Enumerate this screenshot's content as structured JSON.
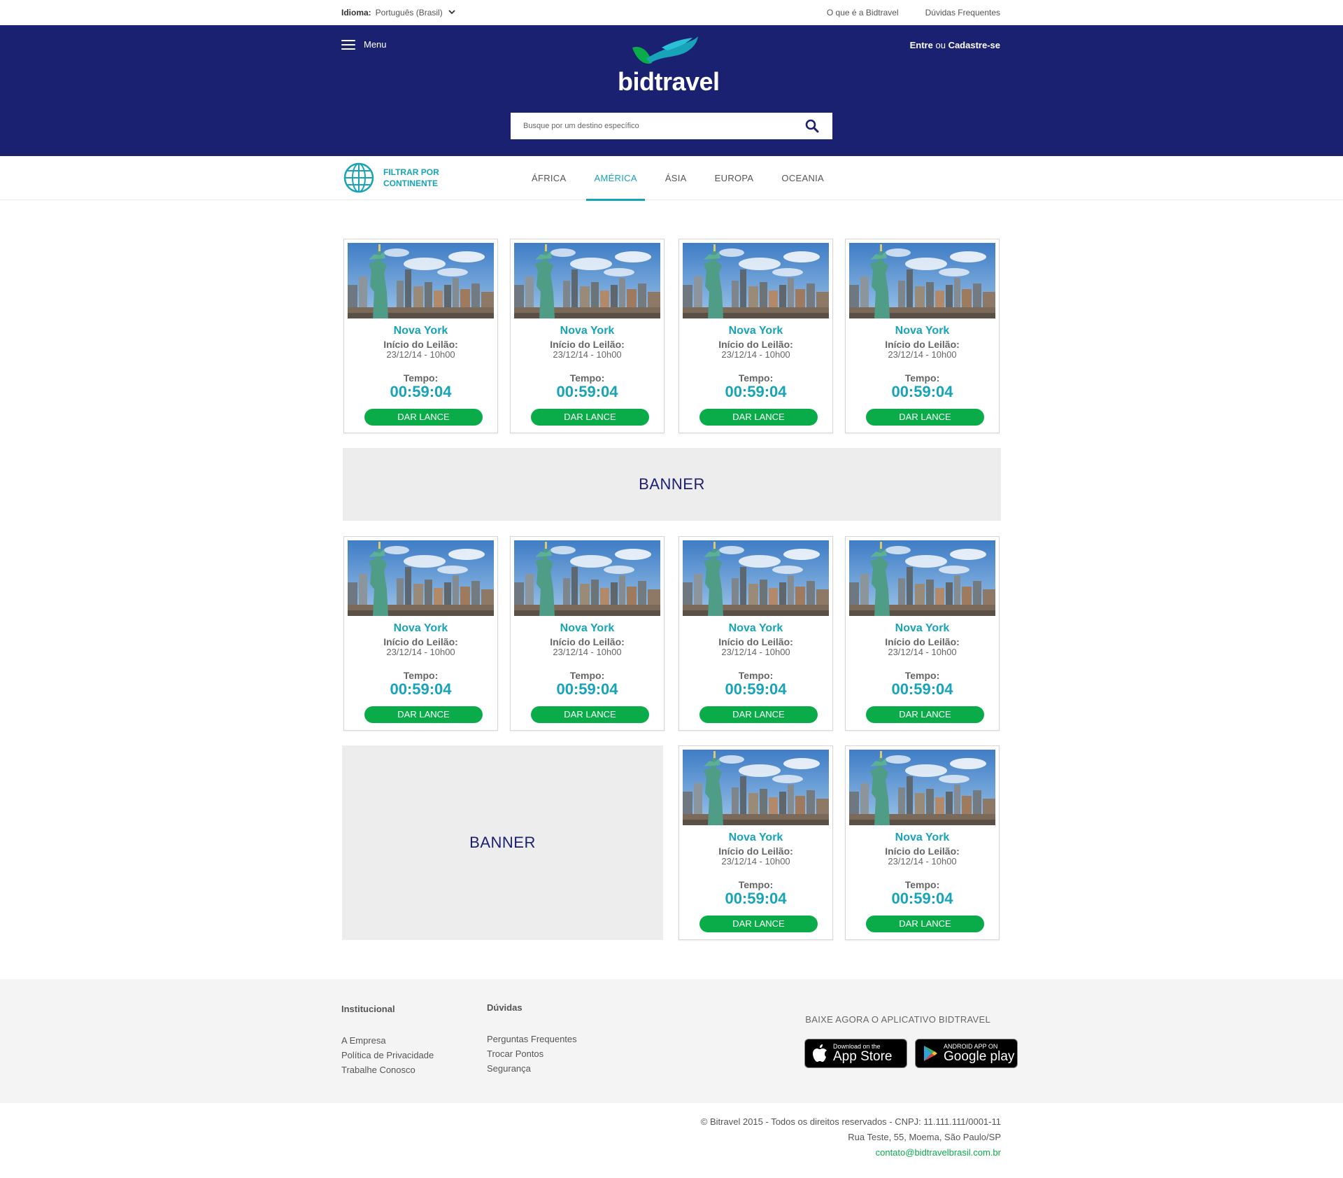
{
  "topbar": {
    "language_label": "Idioma:",
    "language_value": "Português (Brasil)",
    "links": [
      "O que é a Bidtravel",
      "Dúvidas Frequentes"
    ]
  },
  "header": {
    "menu_label": "Menu",
    "login_text": "Entre",
    "login_or": "ou",
    "signup_text": "Cadastre-se",
    "logo_text": "bidtravel",
    "search_placeholder": "Busque por um destino específico"
  },
  "filter": {
    "label": "FILTRAR POR CONTINENTE",
    "tabs": [
      "ÁFRICA",
      "AMÉRICA",
      "ÁSIA",
      "EUROPA",
      "OCEANIA"
    ],
    "active_tab": "AMÉRICA"
  },
  "card": {
    "city": "Nova York",
    "start_label": "Início do Leilão:",
    "start_date": "23/12/14 - 10h00",
    "time_label": "Tempo:",
    "timer": "00:59:04",
    "button_label": "DAR LANCE"
  },
  "banners": [
    "BANNER",
    "BANNER"
  ],
  "footer": {
    "col1_title": "Institucional",
    "col1_links": [
      "A Empresa",
      "Política de Privacidade",
      "Trabalhe Conosco"
    ],
    "col2_title": "Dúvidas",
    "col2_links": [
      "Perguntas Frequentes",
      "Trocar Pontos",
      "Segurança"
    ],
    "app_title": "BAIXE AGORA O APLICATIVO BIDTRAVEL",
    "appstore_small": "Download on the",
    "appstore_big": "App Store",
    "googleplay_small": "ANDROID APP ON",
    "googleplay_big": "Google play",
    "copyright": "© Bitravel 2015 - Todos os direitos reservados - CNPJ: 11.111.111/0001-11",
    "address": "Rua Teste, 55, Moema, São Paulo/SP",
    "email": "contato@bidtravelbrasil.com.br"
  },
  "colors": {
    "header_bg": "#1b2171",
    "accent": "#17a3b8",
    "bid_button": "#0aac4a",
    "banner_bg": "#ededed",
    "footer_bg": "#f4f4f4"
  }
}
